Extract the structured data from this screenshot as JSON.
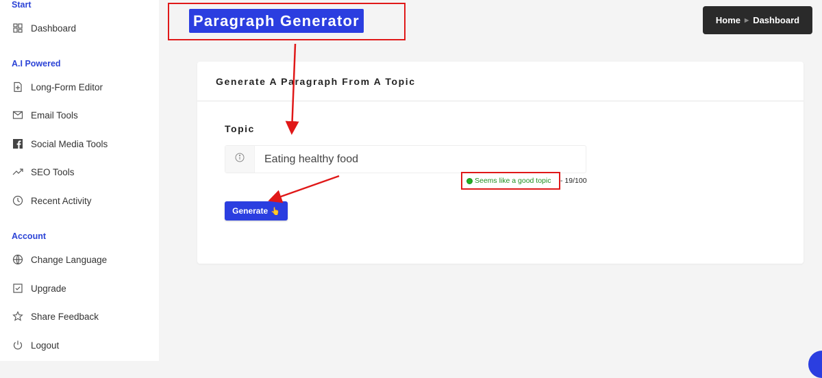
{
  "sidebar": {
    "sections": [
      {
        "label": "Start"
      },
      {
        "label": "A.I Powered"
      },
      {
        "label": "Account"
      }
    ],
    "items": [
      {
        "label": "Dashboard",
        "icon": "dashboard-grid-icon"
      },
      {
        "label": "Long-Form Editor",
        "icon": "document-plus-icon"
      },
      {
        "label": "Email Tools",
        "icon": "envelope-icon"
      },
      {
        "label": "Social Media Tools",
        "icon": "facebook-icon"
      },
      {
        "label": "SEO Tools",
        "icon": "trend-up-icon"
      },
      {
        "label": "Recent Activity",
        "icon": "clock-icon"
      },
      {
        "label": "Change Language",
        "icon": "globe-icon"
      },
      {
        "label": "Upgrade",
        "icon": "checkbox-icon"
      },
      {
        "label": "Share Feedback",
        "icon": "star-icon"
      },
      {
        "label": "Logout",
        "icon": "power-icon"
      }
    ]
  },
  "header": {
    "title": "Paragraph Generator",
    "breadcrumb": {
      "home": "Home",
      "current": "Dashboard"
    }
  },
  "card": {
    "title": "Generate A Paragraph From A Topic",
    "topic_label": "Topic",
    "topic_value": "Eating healthy food",
    "hint": "Seems like a good topic",
    "counter": "- 19/100",
    "generate_label": "Generate",
    "generate_emoji": "👆"
  },
  "colors": {
    "accent": "#2b3ee0",
    "annotation": "#e01818",
    "success": "#1f8f1f"
  }
}
